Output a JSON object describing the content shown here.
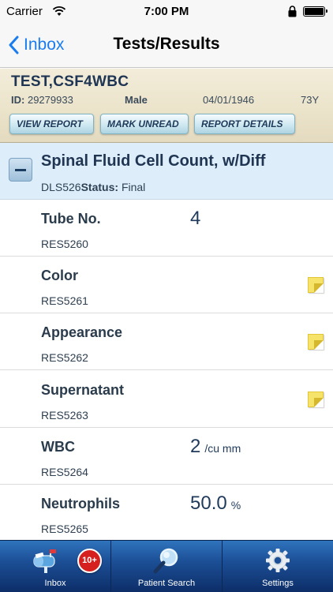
{
  "status_bar": {
    "carrier": "Carrier",
    "time": "7:00 PM"
  },
  "nav": {
    "back_label": "Inbox",
    "title": "Tests/Results"
  },
  "patient": {
    "name": "TEST,CSF4WBC",
    "id_label": "ID:",
    "id": "29279933",
    "sex": "Male",
    "dob": "04/01/1946",
    "age": "73Y"
  },
  "actions": {
    "view_report": "VIEW REPORT",
    "mark_unread": "MARK UNREAD",
    "report_details": "REPORT DETAILS"
  },
  "section": {
    "title": "Spinal Fluid Cell Count, w/Diff",
    "code": "DLS526",
    "status_label": "Status:",
    "status": "Final"
  },
  "results": [
    {
      "name": "Tube No.",
      "code": "RES5260",
      "value": "4",
      "unit": "",
      "has_note": false
    },
    {
      "name": "Color",
      "code": "RES5261",
      "value": "",
      "unit": "",
      "has_note": true
    },
    {
      "name": "Appearance",
      "code": "RES5262",
      "value": "",
      "unit": "",
      "has_note": true
    },
    {
      "name": "Supernatant",
      "code": "RES5263",
      "value": "",
      "unit": "",
      "has_note": true
    },
    {
      "name": "WBC",
      "code": "RES5264",
      "value": "2",
      "unit": "/cu mm",
      "has_note": false
    },
    {
      "name": "Neutrophils",
      "code": "RES5265",
      "value": "50.0",
      "unit": "%",
      "has_note": false
    }
  ],
  "tab_bar": {
    "inbox_label": "Inbox",
    "inbox_badge": "10+",
    "patient_search_label": "Patient Search",
    "settings_label": "Settings"
  },
  "colors": {
    "accent": "#1a7cf0",
    "section_bg": "#ddedf9",
    "tab_bar": "#1c4f96",
    "badge": "#d62020",
    "note": "#f6e46a"
  }
}
